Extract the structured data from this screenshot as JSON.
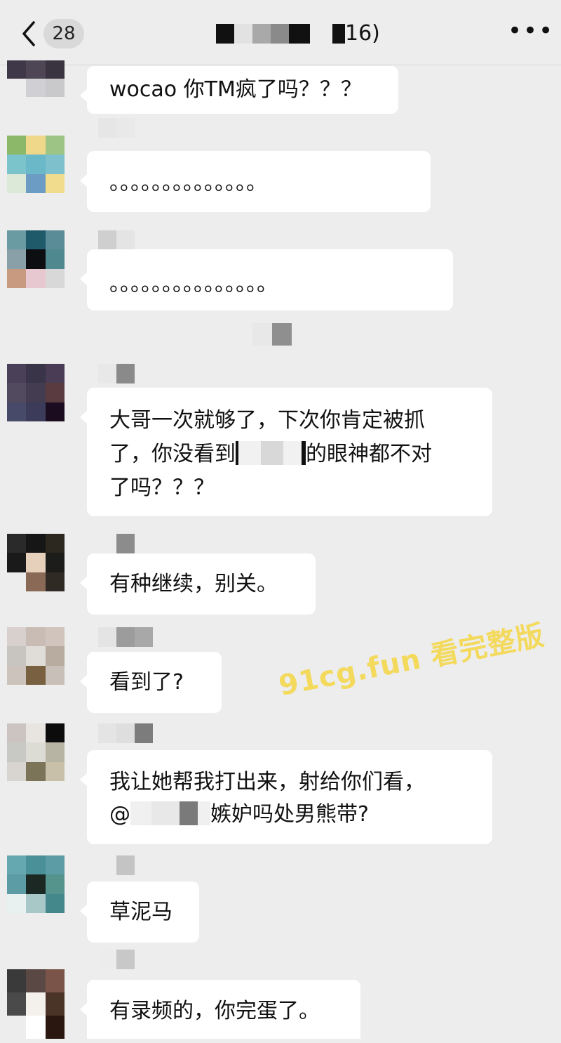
{
  "header": {
    "back_icon": "chevron-left-icon",
    "unread_count": "28",
    "title_suffix": "16)",
    "more_icon": "more-dots-icon",
    "more_glyph": "•••"
  },
  "messages": [
    {
      "text": "wocao 你TM疯了吗？？？"
    },
    {
      "text": "。。。。。。。。。。。。。。"
    },
    {
      "text": "。。。。。。。。。。。。。。。"
    },
    {
      "line1": "大哥一次就够了，下次你肯定被抓",
      "line2a": "了，你没看到",
      "line2b": "的眼神都不对",
      "line3": "了吗？？？"
    },
    {
      "text": "有种继续，别关。"
    },
    {
      "text": "看到了?"
    },
    {
      "line1": "我让她帮我打出来，射给你们看，",
      "line2a": "@",
      "line2b": "嫉妒吗处男熊带?"
    },
    {
      "text": "草泥马"
    },
    {
      "text": "有录频的，你完蛋了。"
    }
  ],
  "watermark": "91cg.fun 看完整版",
  "colors": {
    "background": "#ededed",
    "bubble": "#ffffff",
    "watermark": "#f3d95c"
  }
}
